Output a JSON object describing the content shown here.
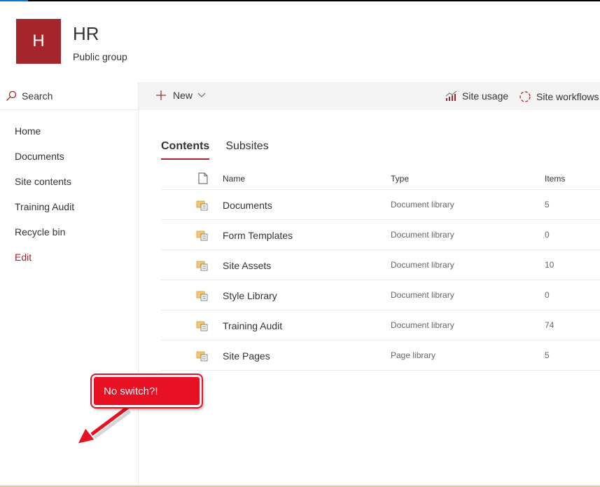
{
  "site": {
    "logo_letter": "H",
    "title": "HR",
    "subtitle": "Public group"
  },
  "search": {
    "label": "Search"
  },
  "leftnav": {
    "items": [
      {
        "label": "Home"
      },
      {
        "label": "Documents"
      },
      {
        "label": "Site contents"
      },
      {
        "label": "Training Audit"
      },
      {
        "label": "Recycle bin"
      },
      {
        "label": "Edit"
      }
    ]
  },
  "commandbar": {
    "new_label": "New",
    "site_usage_label": "Site usage",
    "site_workflows_label": "Site workflows"
  },
  "tabs": [
    {
      "label": "Contents",
      "active": true
    },
    {
      "label": "Subsites",
      "active": false
    }
  ],
  "table": {
    "columns": {
      "name": "Name",
      "type": "Type",
      "items": "Items"
    },
    "rows": [
      {
        "name": "Documents",
        "type": "Document library",
        "items": "5"
      },
      {
        "name": "Form Templates",
        "type": "Document library",
        "items": "0"
      },
      {
        "name": "Site Assets",
        "type": "Document library",
        "items": "10"
      },
      {
        "name": "Style Library",
        "type": "Document library",
        "items": "0"
      },
      {
        "name": "Training Audit",
        "type": "Document library",
        "items": "74"
      },
      {
        "name": "Site Pages",
        "type": "Page library",
        "items": "5"
      }
    ]
  },
  "annotation": {
    "text": "No switch?!"
  },
  "colors": {
    "accent": "#a4262c",
    "callout": "#e81123",
    "commandbar_bg": "#f4f4f4"
  },
  "icons": [
    "search-icon",
    "plus-icon",
    "chevron-down-icon",
    "site-usage-icon",
    "site-workflows-icon",
    "file-icon",
    "library-icon",
    "arrow-icon"
  ]
}
